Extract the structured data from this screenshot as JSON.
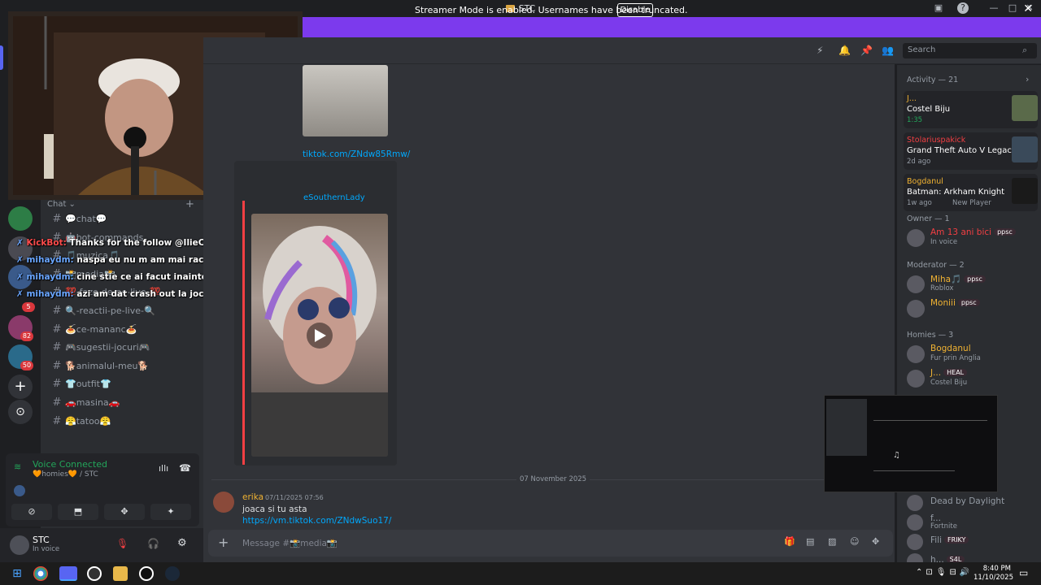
{
  "window": {
    "title": "STC"
  },
  "banner": {
    "text": "Streamer Mode is enabled. Usernames have been truncated.",
    "button": "Disable"
  },
  "search": {
    "placeholder": "Search"
  },
  "channels": {
    "category": "Chat",
    "items": [
      {
        "label": "💬chat💬"
      },
      {
        "label": "🤖bot-commands"
      },
      {
        "label": "🎵muzica🎵"
      },
      {
        "label": "📸media📸"
      },
      {
        "label": "💯-faze-de-pe-live-💯"
      },
      {
        "label": "🔍-reactii-pe-live-🔍"
      },
      {
        "label": "🍝ce-mananc🍝"
      },
      {
        "label": "🎮sugestii-jocuri🎮"
      },
      {
        "label": "🐕animalul-meu🐕"
      },
      {
        "label": "👕outfit👕"
      },
      {
        "label": "🚗masina🚗"
      },
      {
        "label": "😤tatoo😤"
      }
    ]
  },
  "overlay_chat": [
    {
      "user": "KickBot:",
      "text": "Thanks for the follow @IlieCristian",
      "color": "#ff4b4b"
    },
    {
      "user": "mihaydm:",
      "text": "naspa eu nu m am mai racit de mult",
      "color": "#6aa6ff"
    },
    {
      "user": "mihaydm:",
      "text": "cine stie ce ai facut inainte de live",
      "color": "#6aa6ff"
    },
    {
      "user": "mihaydm:",
      "text": "azi am dat crash out la jocu cu 1 dec",
      "color": "#6aa6ff"
    }
  ],
  "guild_badges": {
    "b1": "5",
    "b2": "82",
    "b3": "50"
  },
  "voice": {
    "status": "Voice Connected",
    "location": "🧡homies🧡 / STC"
  },
  "user": {
    "name": "STC",
    "status": "In voice"
  },
  "messages": {
    "link_top": "tiktok.com/ZNdw85Rmw/",
    "embed_author": "eSouthernLady",
    "date_divider": "07 November 2025",
    "author": "erika",
    "timestamp": "07/11/2025 07:56",
    "text": "joaca si tu asta",
    "link": "https://vm.tiktok.com/ZNdwSuo17/"
  },
  "composer": {
    "placeholder": "Message #📸media📸"
  },
  "members": {
    "activity_header": "Activity — 21",
    "activity": [
      {
        "name": "J...",
        "title": "Costel Biju",
        "sub": "1:35",
        "color": "#f0b232"
      },
      {
        "name": "Stolariuspakick",
        "title": "Grand Theft Auto V Legacy",
        "sub": "2d ago",
        "color": "#f23f43"
      },
      {
        "name": "Bogdanul",
        "title": "Batman: Arkham Knight",
        "sub": "1w ago",
        "sub2": "New Player",
        "color": "#f0b232"
      }
    ],
    "owner_header": "Owner — 1",
    "owner": [
      {
        "name": "Am 13 ani bici",
        "pill": "ppsc",
        "sub": "In voice",
        "color": "#f23f43"
      }
    ],
    "moderator_header": "Moderator — 2",
    "moderators": [
      {
        "name": "Miha🎵",
        "pill": "ppsc",
        "sub": "Roblox",
        "color": "#f0b232"
      },
      {
        "name": "Moniii",
        "pill": "ppsc",
        "sub": "",
        "color": "#f0b232"
      }
    ],
    "homies_header": "Homies — 3",
    "homies": [
      {
        "name": "Bogdanul",
        "pill": "",
        "sub": "Fur prin Anglia",
        "color": "#f0b232"
      },
      {
        "name": "J...",
        "pill": "HEAL",
        "sub": "Costel Biju",
        "color": "#f0b232"
      }
    ],
    "more": [
      {
        "name": "Dead by Daylight",
        "sub": ""
      },
      {
        "name": "f...",
        "sub": "Fortnite"
      },
      {
        "name": "Fili",
        "pill": "FRIKY"
      },
      {
        "name": "h...",
        "pill": "S4L"
      }
    ]
  },
  "taskbar": {
    "time": "8:40 PM",
    "date": "11/10/2025"
  },
  "colors": {
    "banner": "#7c3aed",
    "accent": "#5865f2",
    "link": "#00a8fc",
    "voice": "#23a55a"
  }
}
